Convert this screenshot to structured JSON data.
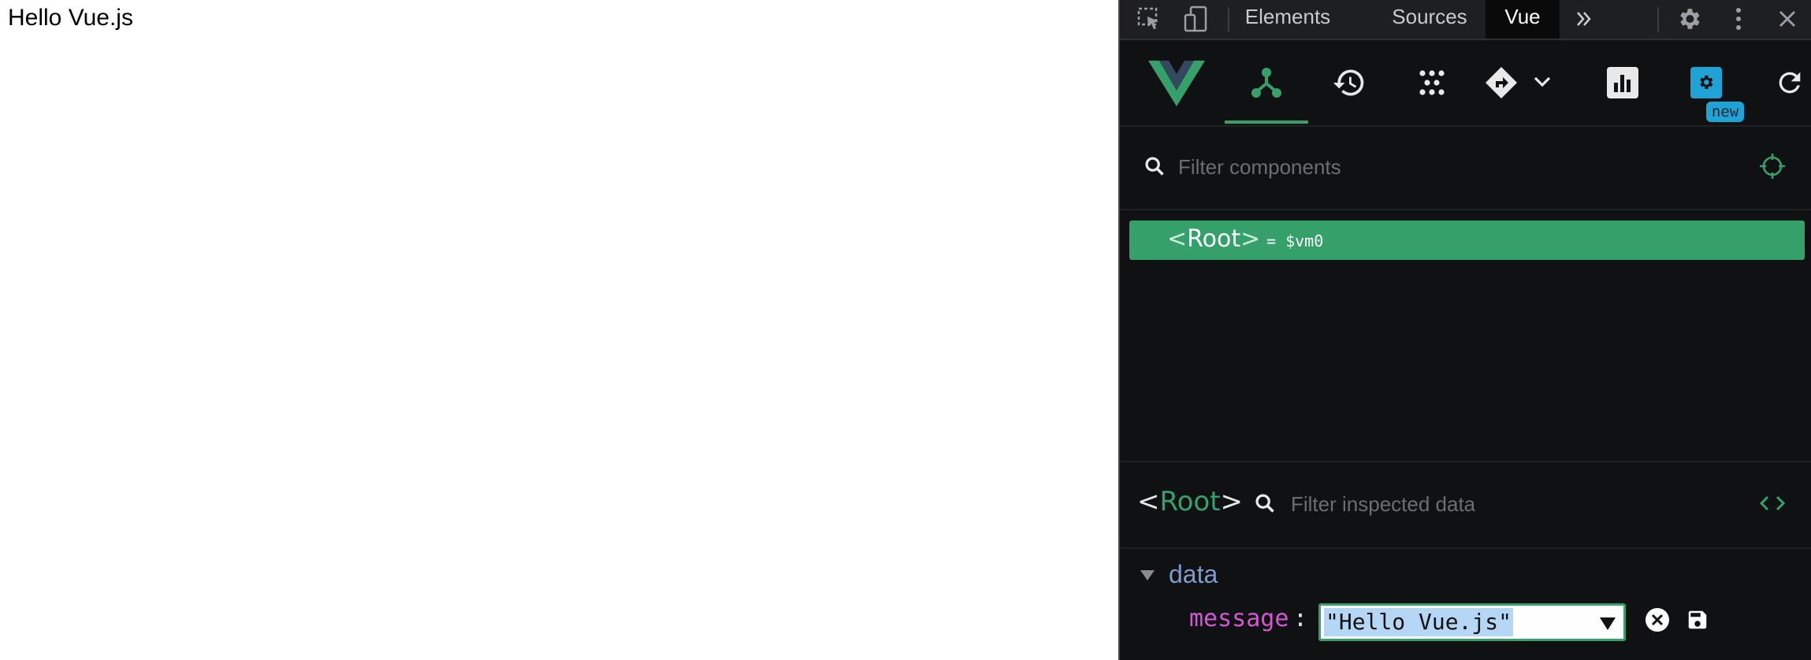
{
  "page": {
    "text": "Hello Vue.js"
  },
  "devtools": {
    "tabs": [
      {
        "label": "Elements"
      },
      {
        "label": "Sources"
      },
      {
        "label": "Vue"
      }
    ],
    "active_tab": "Vue"
  },
  "vue": {
    "toolbar": {
      "settings_badge": "new"
    },
    "component_filter": {
      "placeholder": "Filter components"
    },
    "tree": {
      "root": {
        "open": "<",
        "name": "Root",
        "close": ">",
        "vm_ref": "= $vm0"
      }
    },
    "inspector": {
      "title_open": "<",
      "title_name": "Root",
      "title_close": ">",
      "filter_placeholder": "Filter inspected data",
      "sections": [
        {
          "label": "data",
          "props": [
            {
              "key": "message",
              "colon": ":",
              "value": "\"Hello Vue.js\""
            }
          ]
        }
      ]
    }
  },
  "colors": {
    "vue_green": "#35a06a",
    "badge_blue": "#1fa3d6",
    "key_magenta": "#d457d3",
    "section_blue": "#7e9ccc",
    "panel_bg": "#0f1113"
  },
  "icons": {
    "inspect": "inspect-element-icon",
    "device": "device-toolbar-icon",
    "more_tabs": "more-tabs-icon",
    "settings": "gear-icon",
    "kebab": "kebab-menu-icon",
    "close": "close-icon"
  }
}
